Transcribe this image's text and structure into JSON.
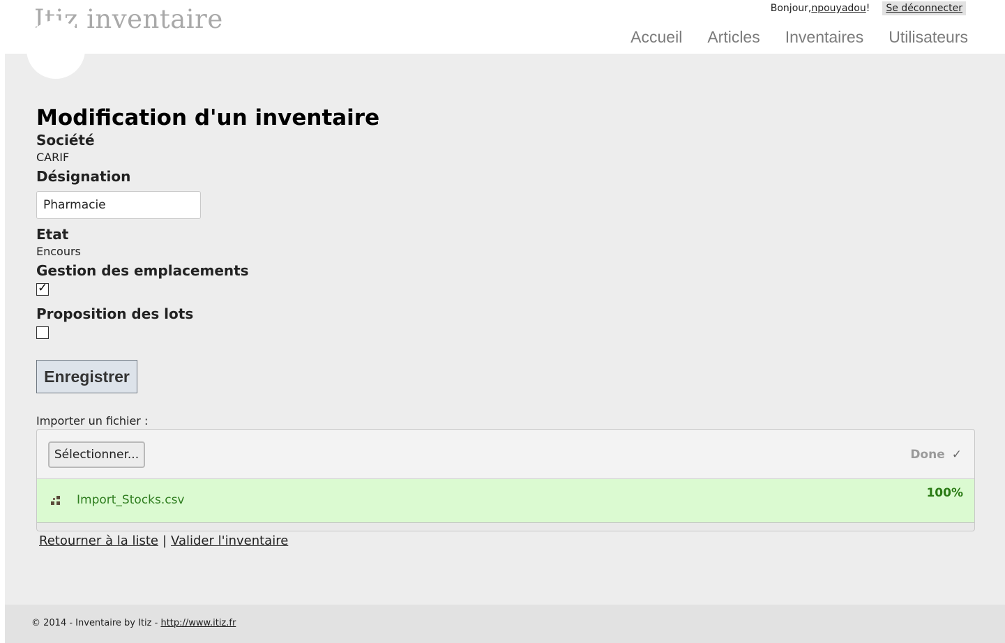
{
  "header": {
    "site_title": "Itiz inventaire",
    "greeting": "Bonjour, ",
    "username": "npouyadou",
    "greeting_suffix": "!",
    "logout": "Se déconnecter",
    "nav": [
      "Accueil",
      "Articles",
      "Inventaires",
      "Utilisateurs"
    ]
  },
  "form": {
    "title": "Modification d'un inventaire",
    "societe_label": "Société",
    "societe_value": "CARIF",
    "designation_label": "Désignation",
    "designation_value": "Pharmacie",
    "etat_label": "Etat",
    "etat_value": "Encours",
    "emplacements_label": "Gestion des emplacements",
    "emplacements_checked": true,
    "lots_label": "Proposition des lots",
    "lots_checked": false,
    "save_button": "Enregistrer"
  },
  "upload": {
    "label": "Importer un fichier :",
    "select_button": "Sélectionner...",
    "status": "Done",
    "status_icon": "check-icon",
    "file_icon": "file-status-icon",
    "file_name": "Import_Stocks.csv",
    "progress_text": "100%",
    "progress": 1.0,
    "progress_color": "#dbfad1"
  },
  "links": {
    "back": "Retourner à la liste",
    "separator": "|",
    "validate": "Valider l'inventaire"
  },
  "footer": {
    "text": "© 2014 - Inventaire by Itiz - ",
    "link": "http://www.itiz.fr"
  }
}
